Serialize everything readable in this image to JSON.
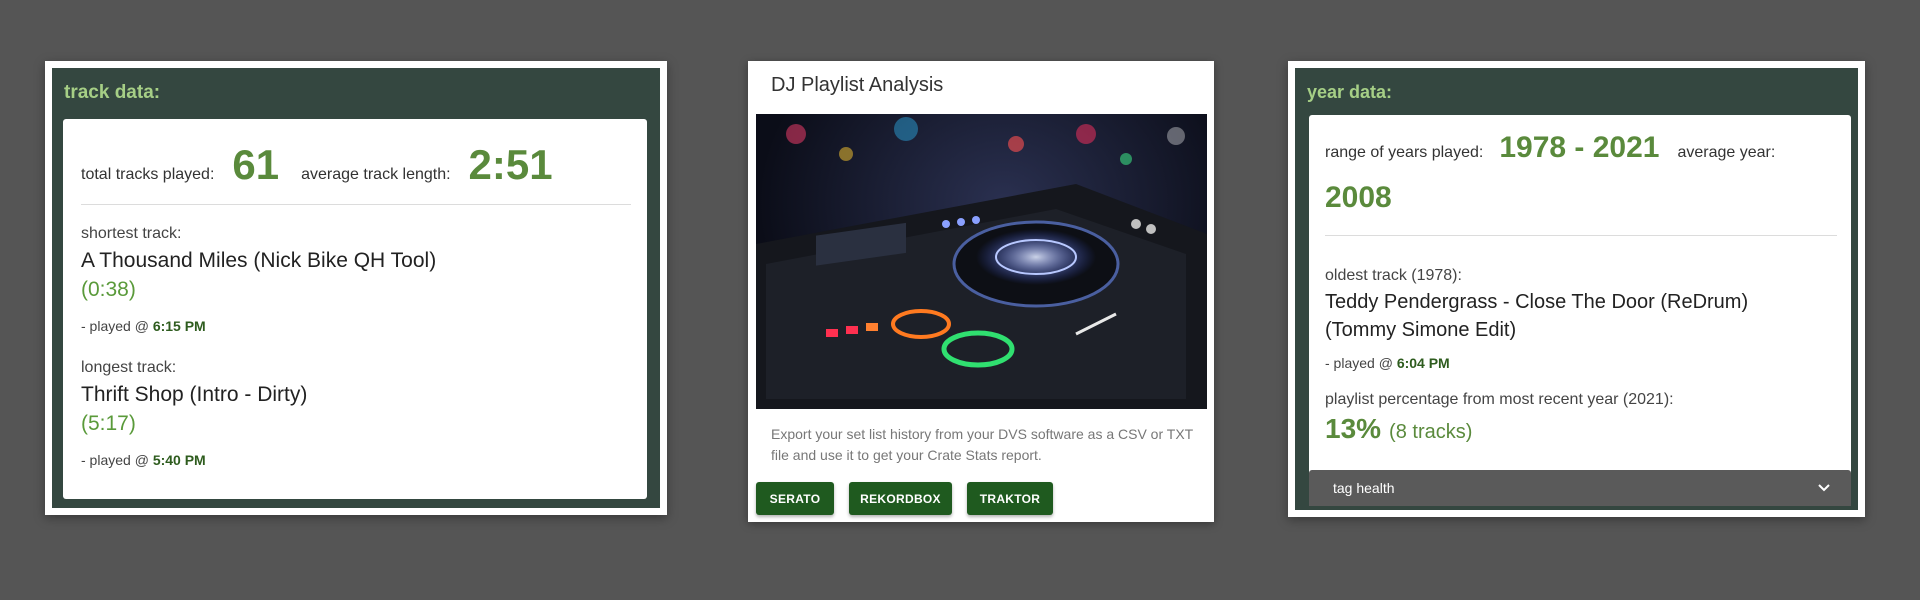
{
  "track_panel": {
    "title": "track data:",
    "total_label": "total tracks played:",
    "total_value": "61",
    "avg_label": "average track length:",
    "avg_value": "2:51",
    "shortest": {
      "label": "shortest track:",
      "title": "A Thousand Miles (Nick Bike QH Tool)",
      "duration": "(0:38)",
      "played_prefix": "- played @ ",
      "played_time": "6:15 PM"
    },
    "longest": {
      "label": "longest track:",
      "title": "Thrift Shop (Intro - Dirty)",
      "duration": "(5:17)",
      "played_prefix": "- played @ ",
      "played_time": "5:40 PM"
    }
  },
  "center_card": {
    "title": "DJ Playlist Analysis",
    "image_description": "DJ controller with glowing jog wheel and colored pads",
    "description": "Export your set list history from your DVS software as a CSV or TXT file and use it to get your Crate Stats report.",
    "buttons": [
      "SERATO",
      "REKORDBOX",
      "TRAKTOR"
    ]
  },
  "year_panel": {
    "title": "year data:",
    "range_label": "range of years played:",
    "range_value": "1978 - 2021",
    "avg_label": "average year:",
    "avg_value": "2008",
    "oldest_label": "oldest track (1978):",
    "oldest_title_line1": "Teddy Pendergrass - Close The Door (ReDrum)",
    "oldest_title_line2": "(Tommy Simone Edit)",
    "played_prefix": "- played @ ",
    "played_time": "6:04 PM",
    "pct_label": "playlist percentage from most recent year (2021):",
    "pct_value": "13%",
    "pct_tracks": "(8 tracks)",
    "accordion_label": "tag health"
  },
  "colors": {
    "background": "#555555",
    "panel_dark": "#344740",
    "accent_green": "#5a8a3c",
    "button_green": "#1f5a1f"
  }
}
